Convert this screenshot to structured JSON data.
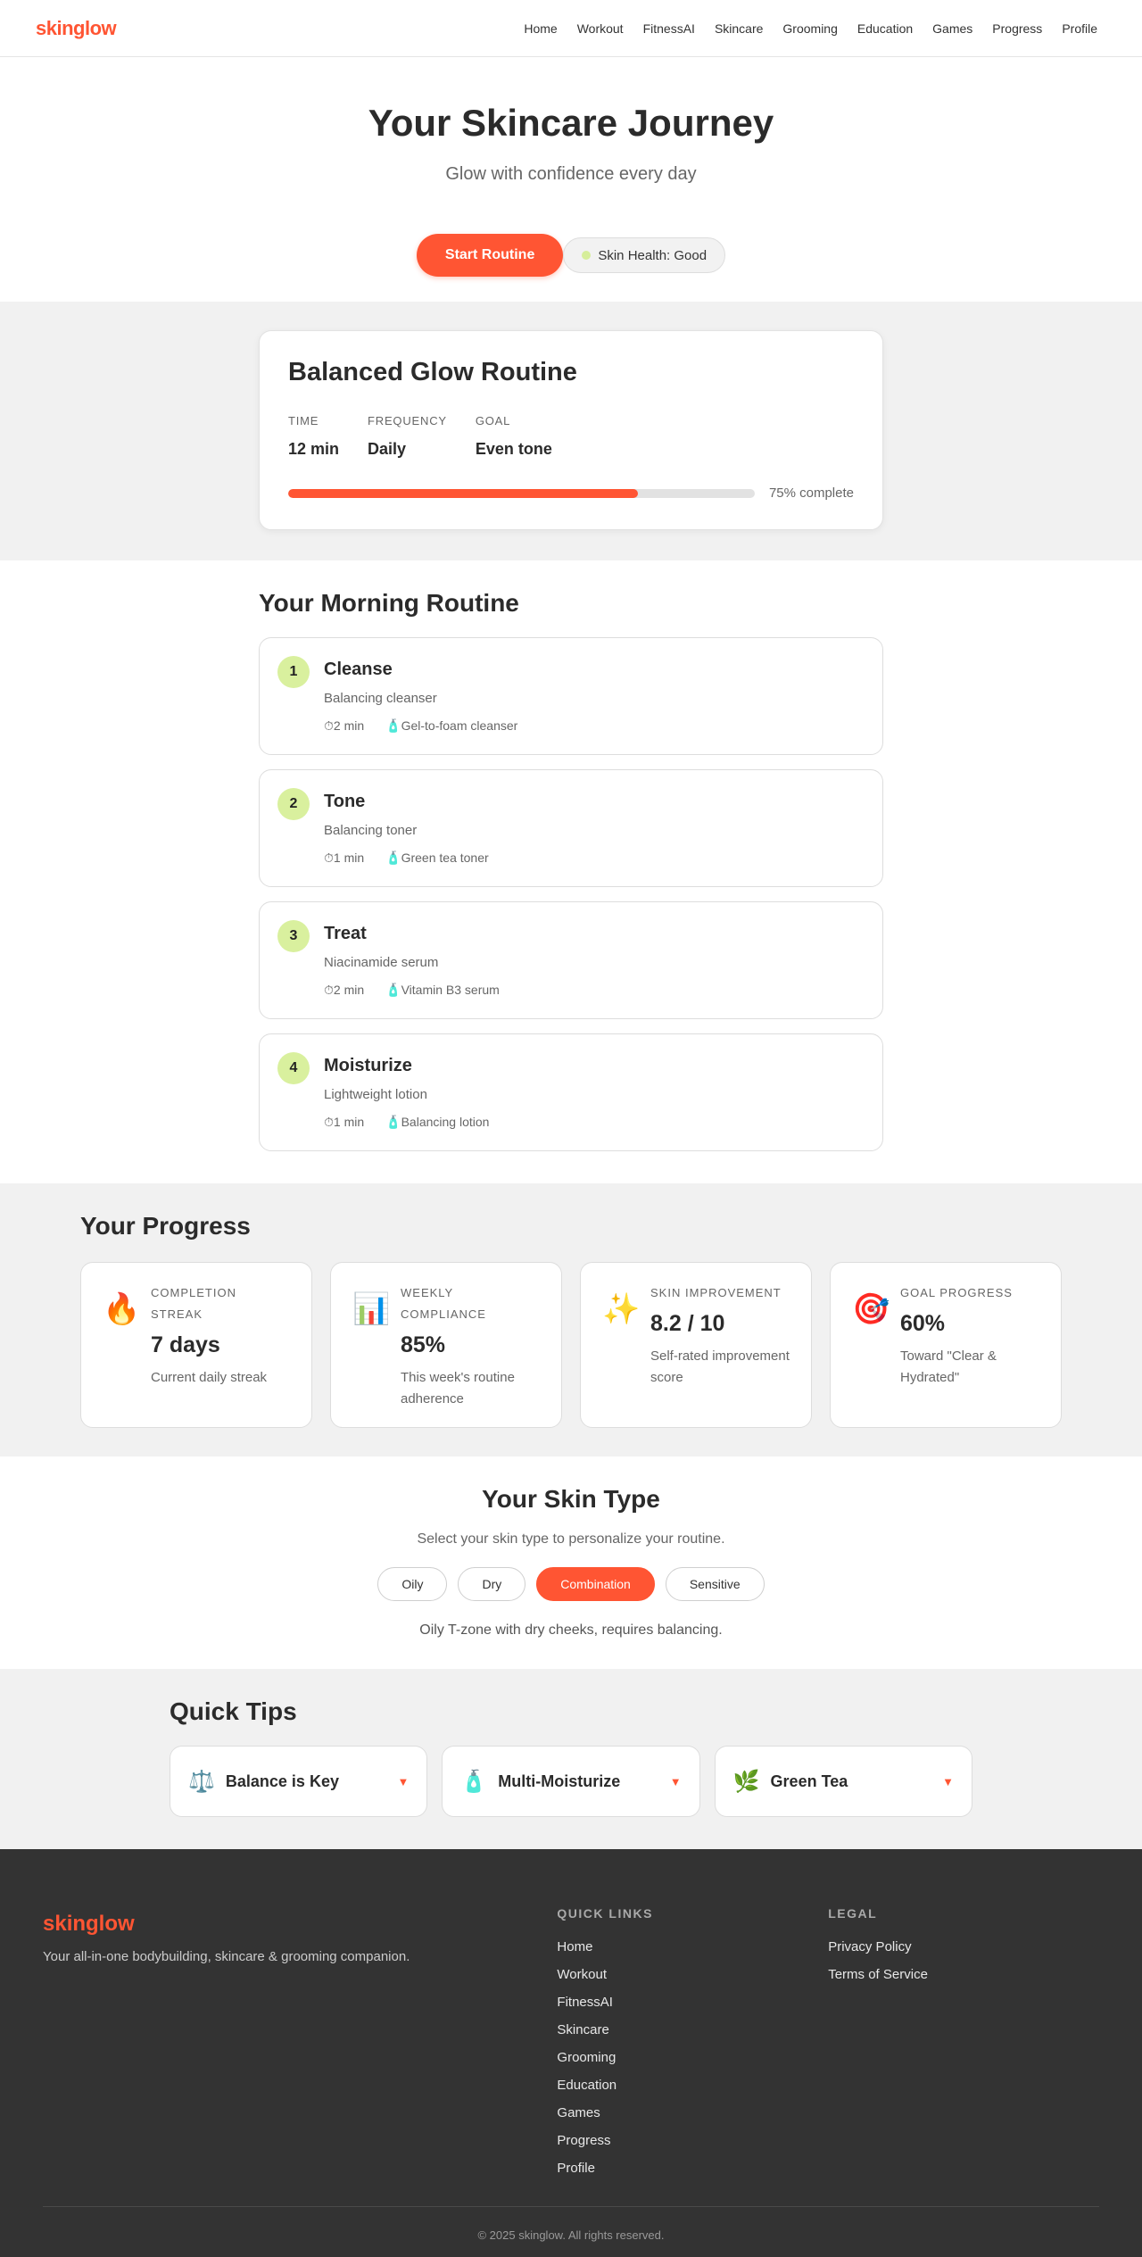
{
  "brand": {
    "logo": "skinglow"
  },
  "nav": {
    "items": [
      "Home",
      "Workout",
      "FitnessAI",
      "Skincare",
      "Grooming",
      "Education",
      "Games",
      "Progress",
      "Profile"
    ]
  },
  "hero": {
    "title": "Your Skincare Journey",
    "subtitle": "Glow with confidence every day",
    "start_button": "Start Routine",
    "health_status": "Skin Health: Good"
  },
  "routine_summary": {
    "title": "Balanced Glow Routine",
    "stats": [
      {
        "label": "Time",
        "value": "12 min"
      },
      {
        "label": "Frequency",
        "value": "Daily"
      },
      {
        "label": "Goal",
        "value": "Even tone"
      }
    ],
    "progress_percent": 75,
    "progress_text": "75% complete"
  },
  "morning": {
    "title": "Your Morning Routine",
    "steps": [
      {
        "number": "1",
        "title": "Cleanse",
        "desc": "Balancing cleanser",
        "time": "⏱2 min",
        "product": "🧴Gel-to-foam cleanser"
      },
      {
        "number": "2",
        "title": "Tone",
        "desc": "Balancing toner",
        "time": "⏱1 min",
        "product": "🧴Green tea toner"
      },
      {
        "number": "3",
        "title": "Treat",
        "desc": "Niacinamide serum",
        "time": "⏱2 min",
        "product": "🧴Vitamin B3 serum"
      },
      {
        "number": "4",
        "title": "Moisturize",
        "desc": "Lightweight lotion",
        "time": "⏱1 min",
        "product": "🧴Balancing lotion"
      }
    ]
  },
  "progress": {
    "title": "Your Progress",
    "kpis": [
      {
        "icon": "🔥",
        "label": "Completion Streak",
        "value": "7 days",
        "desc": "Current daily streak"
      },
      {
        "icon": "📊",
        "label": "Weekly Compliance",
        "value": "85%",
        "desc": "This week's routine adherence"
      },
      {
        "icon": "✨",
        "label": "Skin Improvement",
        "value": "8.2 / 10",
        "desc": "Self-rated improvement score"
      },
      {
        "icon": "🎯",
        "label": "Goal Progress",
        "value": "60%",
        "desc": "Toward \"Clear & Hydrated\""
      }
    ]
  },
  "skin_type": {
    "title": "Your Skin Type",
    "subtitle": "Select your skin type to personalize your routine.",
    "options": [
      "Oily",
      "Dry",
      "Combination",
      "Sensitive"
    ],
    "selected": "Combination",
    "note": "Oily T-zone with dry cheeks, requires balancing."
  },
  "tips": {
    "title": "Quick Tips",
    "items": [
      {
        "icon": "⚖️",
        "title": "Balance is Key",
        "chevron": "▼"
      },
      {
        "icon": "🧴",
        "title": "Multi-Moisturize",
        "chevron": "▼"
      },
      {
        "icon": "🌿",
        "title": "Green Tea",
        "chevron": "▼"
      }
    ]
  },
  "footer": {
    "logo": "skinglow",
    "tagline": "Your all-in-one bodybuilding, skincare & grooming companion.",
    "quick_links_title": "Quick Links",
    "quick_links": [
      "Home",
      "Workout",
      "FitnessAI",
      "Skincare",
      "Grooming",
      "Education",
      "Games",
      "Progress",
      "Profile"
    ],
    "legal_title": "Legal",
    "legal_links": [
      "Privacy Policy",
      "Terms of Service"
    ],
    "copyright": "© 2025 skinglow. All rights reserved."
  },
  "colors": {
    "accent": "#ff5533",
    "step_badge": "#d9f09e",
    "footer_bg": "#333333"
  }
}
